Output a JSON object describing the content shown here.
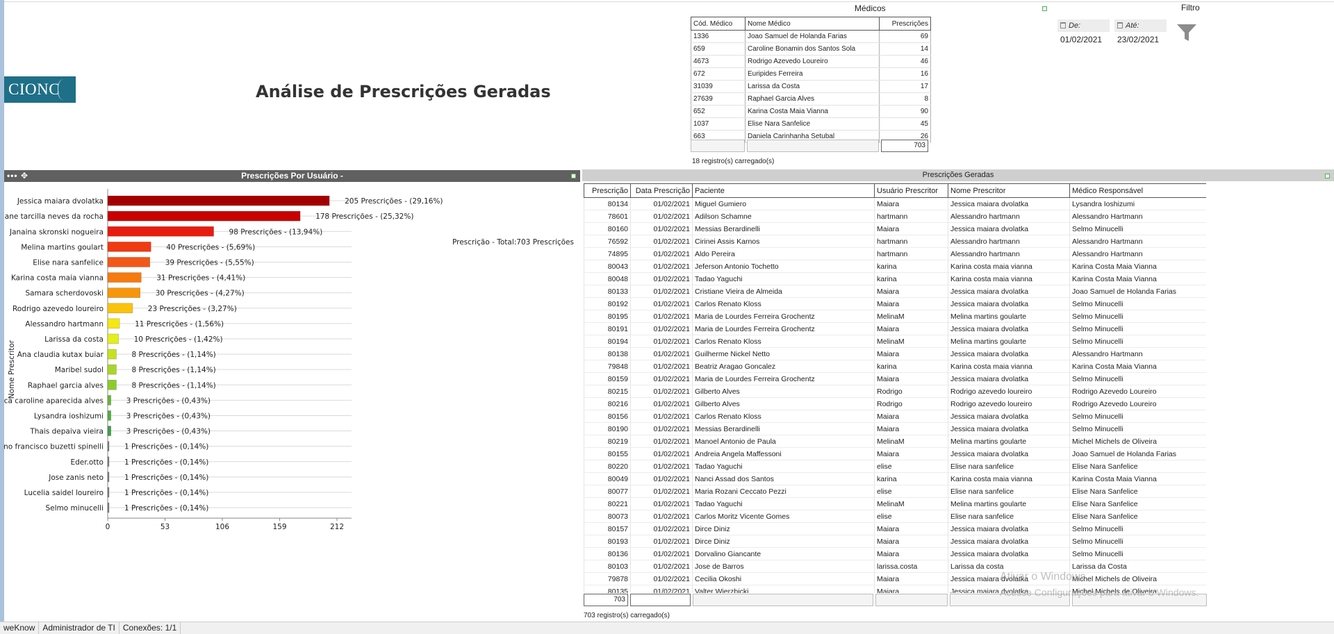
{
  "header": {
    "logo_text": "CIONC",
    "title": "Análise de Prescrições Geradas"
  },
  "medicos": {
    "title": "Médicos",
    "columns": [
      "Cód. Médico",
      "Nome Médico",
      "Prescrições"
    ],
    "rows": [
      [
        "1336",
        "Joao Samuel de Holanda Farias",
        "69"
      ],
      [
        "659",
        "Caroline Bonamin dos Santos Sola",
        "14"
      ],
      [
        "4673",
        "Rodrigo Azevedo Loureiro",
        "46"
      ],
      [
        "672",
        "Euripides Ferreira",
        "16"
      ],
      [
        "31039",
        "Larissa da Costa",
        "17"
      ],
      [
        "27639",
        "Raphael Garcia Alves",
        "8"
      ],
      [
        "652",
        "Karina Costa Maia Vianna",
        "90"
      ],
      [
        "1037",
        "Elise Nara Sanfelice",
        "45"
      ],
      [
        "663",
        "Daniela Carinhanha Setubal",
        "26"
      ]
    ],
    "total": "703",
    "loaded": "18 registro(s) carregado(s)"
  },
  "filtro": {
    "title": "Filtro",
    "de_label": "De:",
    "de_value": "01/02/2021",
    "ate_label": "Até:",
    "ate_value": "23/02/2021"
  },
  "chart_panel": {
    "title": "Prescrições Por Usuário -",
    "icons": "••• ✥"
  },
  "chart_data": {
    "type": "bar",
    "orientation": "horizontal",
    "ylabel": "Nome Prescritor",
    "total_label": "Prescrição - Total:703 Prescrições",
    "xlim": [
      0,
      212
    ],
    "xticks": [
      "0",
      "53",
      "106",
      "159",
      "212"
    ],
    "grid": true,
    "categories": [
      "Jessica maiara dvolatka",
      "Dariane tarcilla neves da rocha",
      "Janaina skronski nogueira",
      "Melina martins goulart",
      "Elise nara sanfelice",
      "Karina costa maia vianna",
      "Samara scherdovoski",
      "Rodrigo azevedo loureiro",
      "Alessandro hartmann",
      "Larissa da costa",
      "Ana claudia kutax buiar",
      "Maribel sudol",
      "Raphael garcia alves",
      "Bianca caroline aparecida alves",
      "Lysandra ioshizumi",
      "Thais depaiva vieira",
      "Bruno francisco buzetti spinelli",
      "Eder.otto",
      "Jose zanis neto",
      "Lucelia saidel loureiro",
      "Selmo minucelli"
    ],
    "values": [
      205,
      178,
      98,
      40,
      39,
      31,
      30,
      23,
      11,
      10,
      8,
      8,
      8,
      3,
      3,
      3,
      1,
      1,
      1,
      1,
      1
    ],
    "data_labels": [
      "205 Prescrições - (29,16%)",
      "178 Prescrições - (25,32%)",
      "98 Prescrições - (13,94%)",
      "40 Prescrições - (5,69%)",
      "39 Prescrições - (5,55%)",
      "31 Prescrições - (4,41%)",
      "30 Prescrições - (4,27%)",
      "23 Prescrições - (3,27%)",
      "11 Prescrições - (1,56%)",
      "10 Prescrições - (1,42%)",
      "8 Prescrições - (1,14%)",
      "8 Prescrições - (1,14%)",
      "8 Prescrições - (1,14%)",
      "3 Prescrições - (0,43%)",
      "3 Prescrições - (0,43%)",
      "3 Prescrições - (0,43%)",
      "1 Prescrições - (0,14%)",
      "1 Prescrições - (0,14%)",
      "1 Prescrições - (0,14%)",
      "1 Prescrições - (0,14%)",
      "1 Prescrições - (0,14%)"
    ],
    "colors": [
      "#a50000",
      "#c80000",
      "#e81c0e",
      "#ef3a12",
      "#f25818",
      "#f57a10",
      "#f7960c",
      "#fbc20c",
      "#f5e614",
      "#e2ee1e",
      "#c5e21c",
      "#a8d62a",
      "#8ccb2e",
      "#66b63c",
      "#52ad44",
      "#3ea04a",
      "#808080",
      "#808080",
      "#808080",
      "#808080",
      "#808080"
    ]
  },
  "prescricoes": {
    "title": "Prescrições Geradas",
    "columns": [
      "Prescrição",
      "Data Prescrição",
      "Paciente",
      "Usuário Prescritor",
      "Nome Prescritor",
      "Médico Responsável"
    ],
    "rows": [
      [
        "80134",
        "01/02/2021",
        "Miguel Gumiero",
        "Maiara",
        "Jessica maiara dvolatka",
        "Lysandra Ioshizumi"
      ],
      [
        "78601",
        "01/02/2021",
        "Adilson Schamne",
        "hartmann",
        "Alessandro hartmann",
        "Alessandro Hartmann"
      ],
      [
        "80160",
        "01/02/2021",
        "Messias Berardinelli",
        "Maiara",
        "Jessica maiara dvolatka",
        "Selmo Minucelli"
      ],
      [
        "76592",
        "01/02/2021",
        "Cirinei Assis Karnos",
        "hartmann",
        "Alessandro hartmann",
        "Alessandro Hartmann"
      ],
      [
        "74895",
        "01/02/2021",
        "Aldo Pereira",
        "hartmann",
        "Alessandro hartmann",
        "Alessandro Hartmann"
      ],
      [
        "80043",
        "01/02/2021",
        "Jeferson Antonio Tochetto",
        "karina",
        "Karina costa maia vianna",
        "Karina Costa Maia Vianna"
      ],
      [
        "80048",
        "01/02/2021",
        "Tadao Yaguchi",
        "karina",
        "Karina costa maia vianna",
        "Karina Costa Maia Vianna"
      ],
      [
        "80133",
        "01/02/2021",
        "Cristiane Vieira de Almeida",
        "Maiara",
        "Jessica maiara dvolatka",
        "Joao Samuel de Holanda Farias"
      ],
      [
        "80192",
        "01/02/2021",
        "Carlos Renato Kloss",
        "Maiara",
        "Jessica maiara dvolatka",
        "Selmo Minucelli"
      ],
      [
        "80195",
        "01/02/2021",
        "Maria de Lourdes Ferreira Grochentz",
        "MelinaM",
        "Melina martins goularte",
        "Selmo Minucelli"
      ],
      [
        "80191",
        "01/02/2021",
        "Maria de Lourdes Ferreira Grochentz",
        "Maiara",
        "Jessica maiara dvolatka",
        "Selmo Minucelli"
      ],
      [
        "80194",
        "01/02/2021",
        "Carlos Renato Kloss",
        "MelinaM",
        "Melina martins goularte",
        "Selmo Minucelli"
      ],
      [
        "80138",
        "01/02/2021",
        "Guilherme Nickel Netto",
        "Maiara",
        "Jessica maiara dvolatka",
        "Alessandro Hartmann"
      ],
      [
        "79848",
        "01/02/2021",
        "Beatriz Aragao Goncalez",
        "karina",
        "Karina costa maia vianna",
        "Karina Costa Maia Vianna"
      ],
      [
        "80159",
        "01/02/2021",
        "Maria de Lourdes Ferreira Grochentz",
        "Maiara",
        "Jessica maiara dvolatka",
        "Selmo Minucelli"
      ],
      [
        "80215",
        "01/02/2021",
        "Gilberto Alves",
        "Rodrigo",
        "Rodrigo azevedo loureiro",
        "Rodrigo Azevedo Loureiro"
      ],
      [
        "80216",
        "01/02/2021",
        "Gilberto Alves",
        "Rodrigo",
        "Rodrigo azevedo loureiro",
        "Rodrigo Azevedo Loureiro"
      ],
      [
        "80156",
        "01/02/2021",
        "Carlos Renato Kloss",
        "Maiara",
        "Jessica maiara dvolatka",
        "Selmo Minucelli"
      ],
      [
        "80190",
        "01/02/2021",
        "Messias Berardinelli",
        "Maiara",
        "Jessica maiara dvolatka",
        "Selmo Minucelli"
      ],
      [
        "80219",
        "01/02/2021",
        "Manoel Antonio de Paula",
        "MelinaM",
        "Melina martins goularte",
        "Michel Michels de Oliveira"
      ],
      [
        "80155",
        "01/02/2021",
        "Andreia Angela Maffessoni",
        "Maiara",
        "Jessica maiara dvolatka",
        "Joao Samuel de Holanda Farias"
      ],
      [
        "80220",
        "01/02/2021",
        "Tadao Yaguchi",
        "elise",
        "Elise nara sanfelice",
        "Elise Nara Sanfelice"
      ],
      [
        "80049",
        "01/02/2021",
        "Nanci Assad dos Santos",
        "karina",
        "Karina costa maia vianna",
        "Karina Costa Maia Vianna"
      ],
      [
        "80077",
        "01/02/2021",
        "Maria Rozani Ceccato Pezzi",
        "elise",
        "Elise nara sanfelice",
        "Elise Nara Sanfelice"
      ],
      [
        "80221",
        "01/02/2021",
        "Tadao Yaguchi",
        "MelinaM",
        "Melina martins goularte",
        "Elise Nara Sanfelice"
      ],
      [
        "80073",
        "01/02/2021",
        "Carlos Moritz Vicente Gomes",
        "elise",
        "Elise nara sanfelice",
        "Elise Nara Sanfelice"
      ],
      [
        "80157",
        "01/02/2021",
        "Dirce Diniz",
        "Maiara",
        "Jessica maiara dvolatka",
        "Selmo Minucelli"
      ],
      [
        "80193",
        "01/02/2021",
        "Dirce Diniz",
        "Maiara",
        "Jessica maiara dvolatka",
        "Selmo Minucelli"
      ],
      [
        "80136",
        "01/02/2021",
        "Dorvalino Giancante",
        "Maiara",
        "Jessica maiara dvolatka",
        "Selmo Minucelli"
      ],
      [
        "80103",
        "01/02/2021",
        "Jose de Barros",
        "larissa.costa",
        "Larissa da costa",
        "Larissa da Costa"
      ],
      [
        "79878",
        "01/02/2021",
        "Cecilia Okoshi",
        "Maiara",
        "Jessica maiara dvolatka",
        "Michel Michels de Oliveira"
      ],
      [
        "80135",
        "01/02/2021",
        "Valter Wierzbicki",
        "Maiara",
        "Jessica maiara dvolatka",
        "Michel Michels de Oliveira"
      ]
    ],
    "total": "703",
    "loaded": "703 registro(s) carregado(s)"
  },
  "watermark": {
    "line1": "Ativar o Windows",
    "line2": "Acesse Configurações para ativar o Windows."
  },
  "status_bar": {
    "app": "weKnow",
    "user": "Administrador de TI",
    "conexoes": "Conexões: 1/1"
  }
}
